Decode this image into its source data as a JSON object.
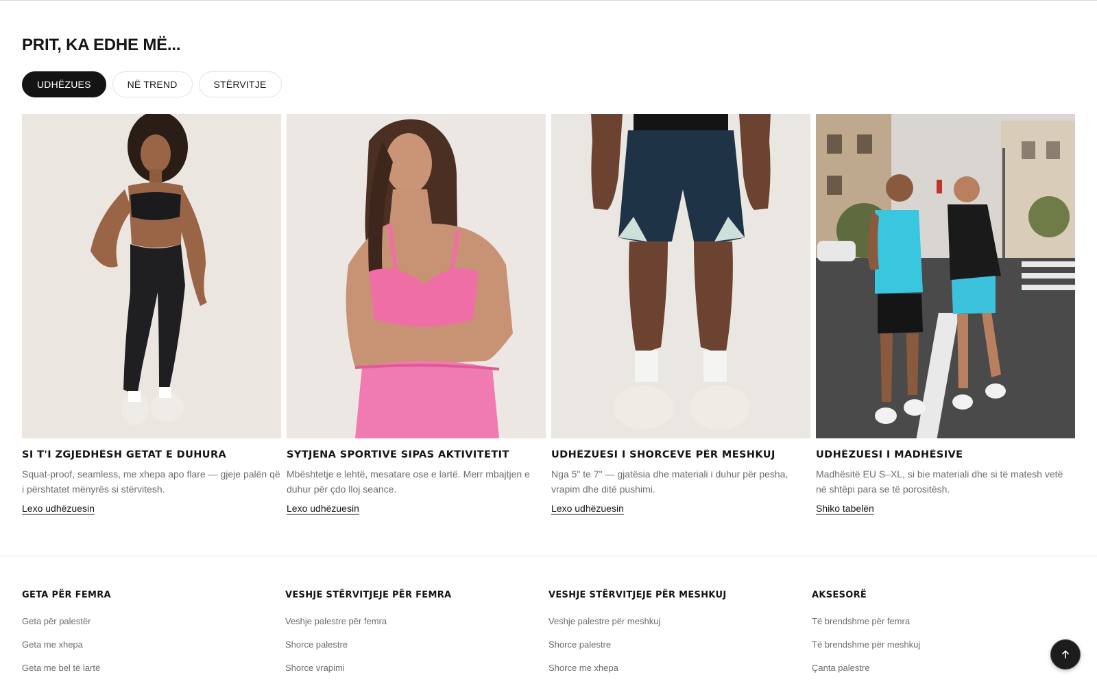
{
  "section": {
    "title": "PRIT, KA EDHE MË...",
    "tabs": [
      {
        "label": "UDHËZUES",
        "active": true
      },
      {
        "label": "NË TREND",
        "active": false
      },
      {
        "label": "STËRVITJE",
        "active": false
      }
    ]
  },
  "cards": [
    {
      "image_icon": "woman-black-leggings-photo",
      "title": "SI T'I ZGJEDHËSH GETAT E DUHURA",
      "description": "Squat-proof, seamless, me xhepa apo flare — gjeje palën që i përshtatet mënyrës si stërvitesh.",
      "link": "Lexo udhëzuesin"
    },
    {
      "image_icon": "woman-pink-sports-bra-photo",
      "title": "SYTJENA SPORTIVE SIPAS AKTIVITETIT",
      "description": "Mbështetje e lehtë, mesatare ose e lartë. Merr mbajtjen e duhur për çdo lloj seance.",
      "link": "Lexo udhëzuesin"
    },
    {
      "image_icon": "man-navy-shorts-photo",
      "title": "UDHËZUESI I SHORCEVE PËR MESHKUJ",
      "description": "Nga 5\" te 7\" — gjatësia dhe materiali i duhur për pesha, vrapim dhe ditë pushimi.",
      "link": "Lexo udhëzuesin"
    },
    {
      "image_icon": "runners-street-photo",
      "title": "UDHËZUESI I MADHËSIVE",
      "description": "Madhësitë EU S–XL, si bie materiali dhe si të matesh vetë në shtëpi para se të porositësh.",
      "link": "Shiko tabelën"
    }
  ],
  "footer": {
    "columns": [
      {
        "heading": "GETA PËR FEMRA",
        "links": [
          "Geta për palestër",
          "Geta me xhepa",
          "Geta me bel të lartë"
        ]
      },
      {
        "heading": "VESHJE STËRVITJEJE PËR FEMRA",
        "links": [
          "Veshje palestre për femra",
          "Shorce palestre",
          "Shorce vrapimi"
        ]
      },
      {
        "heading": "VESHJE STËRVITJEJE PËR MESHKUJ",
        "links": [
          "Veshje palestre për meshkuj",
          "Shorce palestre",
          "Shorce me xhepa"
        ]
      },
      {
        "heading": "AKSESORË",
        "links": [
          "Të brendshme për femra",
          "Të brendshme për meshkuj",
          "Çanta palestre"
        ]
      }
    ]
  },
  "back_to_top_icon": "arrow-up-icon",
  "colors": {
    "accent_dark": "#141414",
    "muted_text": "#6c6c6c",
    "divider": "#e6e6e6"
  }
}
